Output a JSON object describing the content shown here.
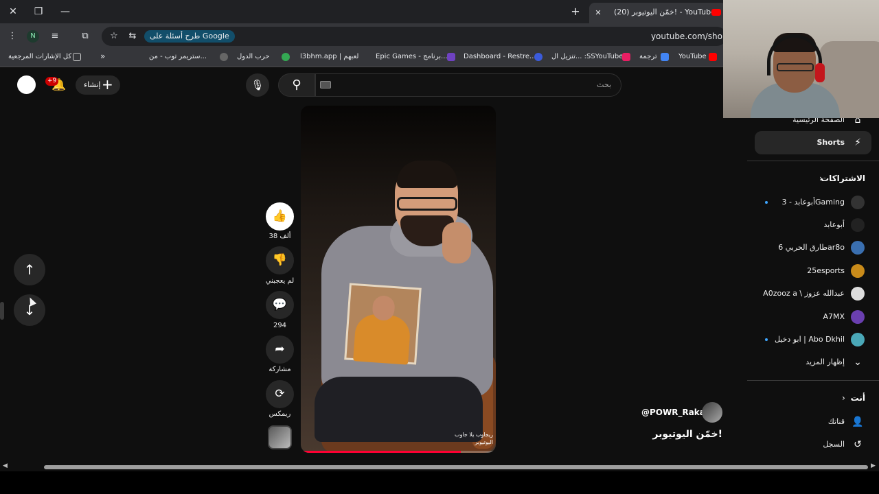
{
  "browser": {
    "tab_title": "(20) خمّن اليوتيوبر! - YouTube",
    "url": "youtube.com/sho",
    "google_ask": "طرح أسئلة على Google",
    "profile_initial": "N",
    "bookmarks": [
      {
        "label": "YouTube",
        "color": "#ff0000"
      },
      {
        "label": "ترجمة",
        "color": "#4285f4"
      },
      {
        "label": "تنزيل ال... :SSYouTube",
        "color": "#e91e63"
      },
      {
        "label": "Dashboard - Restre...",
        "color": "#3b5bdb"
      },
      {
        "label": "Epic Games - برنامج...",
        "color": "#6f42c1"
      },
      {
        "label": "l3bhm.app | لعبهم",
        "color": "#555555"
      },
      {
        "label": "حرب الدول",
        "color": "#34a853"
      },
      {
        "label": "ستريمر توب - من...",
        "color": "#666666"
      }
    ],
    "all_bookmarks": "كل الإشارات المرجعية"
  },
  "header": {
    "notifications_badge": "+9",
    "create_label": "إنشاء",
    "search_placeholder": "بحث"
  },
  "actions": {
    "like_count": "38 ألف",
    "dislike_label": "لم يعجبني",
    "comments_count": "294",
    "share_label": "مشاركة",
    "remix_label": "ريمكس"
  },
  "video": {
    "caption_line1": "ريجاوب يلا جاوب",
    "caption_line2": "اليوتيوبر",
    "progress": 0.82
  },
  "channel": {
    "handle": "@POWR_Rakan",
    "title": "خمّن اليوتيوبر!"
  },
  "sidebar": {
    "home_label": "الصفحة الرئيسية",
    "shorts_label": "Shorts",
    "subscriptions_label": "الاشتراكات",
    "subscriptions": [
      {
        "name": "أبوعابد - 3Gaming",
        "dot": true,
        "color": "#333333"
      },
      {
        "name": "أبوعابد",
        "dot": false,
        "color": "#222222"
      },
      {
        "name": "طارق الحربي 6ar8o",
        "dot": false,
        "color": "#3a6fb0"
      },
      {
        "name": "25esports",
        "dot": false,
        "color": "#c98b1a"
      },
      {
        "name": "A0zooz a \\ عبدالله عزوز",
        "dot": false,
        "color": "#dddddd"
      },
      {
        "name": "A7MX",
        "dot": false,
        "color": "#6a3fb0"
      },
      {
        "name": "ابو دخيل | Abo Dkhil",
        "dot": true,
        "color": "#4aa8b8"
      }
    ],
    "show_more_label": "إظهار المزيد",
    "you_label": "أنت",
    "channel_label": "قناتك",
    "history_label": "السجل"
  }
}
